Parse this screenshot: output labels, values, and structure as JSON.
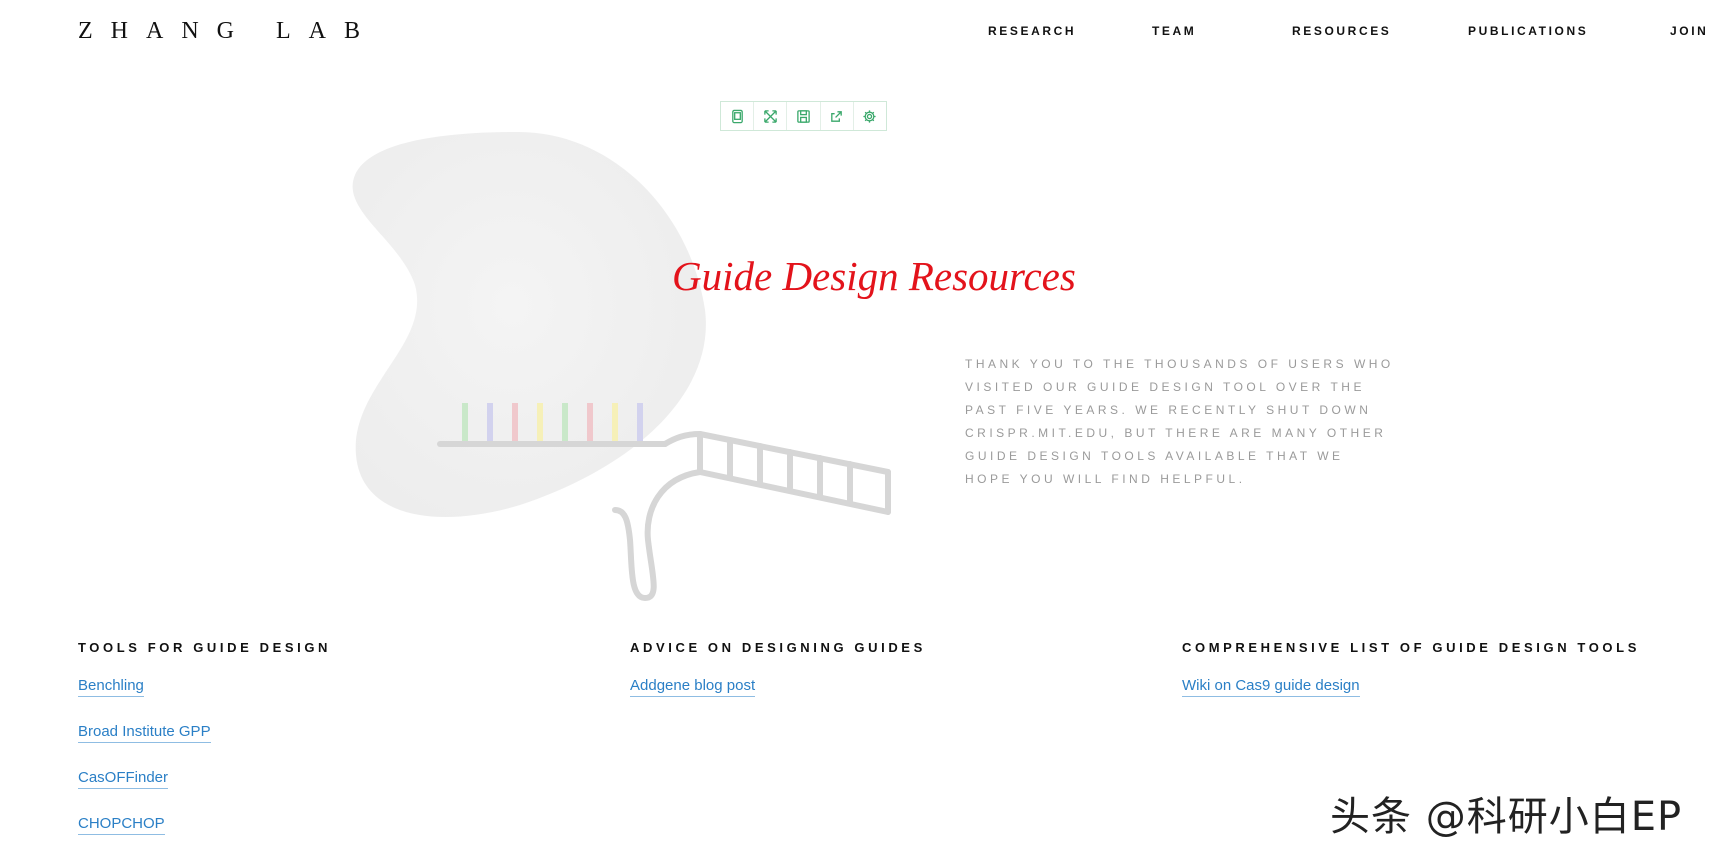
{
  "header": {
    "logo": "ZHANG LAB",
    "nav": [
      "RESEARCH",
      "TEAM",
      "RESOURCES",
      "PUBLICATIONS",
      "JOIN"
    ]
  },
  "toolbar": {
    "icons": [
      "tablet-icon",
      "expand-icon",
      "save-icon",
      "share-icon",
      "gear-icon"
    ]
  },
  "hero": {
    "title": "Guide Design Resources",
    "description": "THANK YOU TO THE THOUSANDS OF USERS WHO VISITED OUR GUIDE DESIGN TOOL OVER THE PAST FIVE YEARS. WE RECENTLY SHUT DOWN CRISPR.MIT.EDU, BUT THERE ARE MANY OTHER GUIDE DESIGN TOOLS AVAILABLE THAT WE HOPE YOU WILL FIND HELPFUL.",
    "title_color": "#e3131b"
  },
  "sections": [
    {
      "heading": "TOOLS FOR GUIDE DESIGN",
      "links": [
        "Benchling",
        "Broad Institute GPP",
        "CasOFFinder",
        "CHOPCHOP"
      ]
    },
    {
      "heading": "ADVICE ON DESIGNING GUIDES",
      "links": [
        "Addgene blog post"
      ]
    },
    {
      "heading": "COMPREHENSIVE LIST OF GUIDE DESIGN TOOLS",
      "links": [
        "Wiki on Cas9 guide design"
      ]
    }
  ],
  "watermark": "头条 @科研小白EP",
  "colors": {
    "link": "#2a7fc6",
    "accent": "#e3131b",
    "toolbar_icon": "#3aa86b"
  }
}
